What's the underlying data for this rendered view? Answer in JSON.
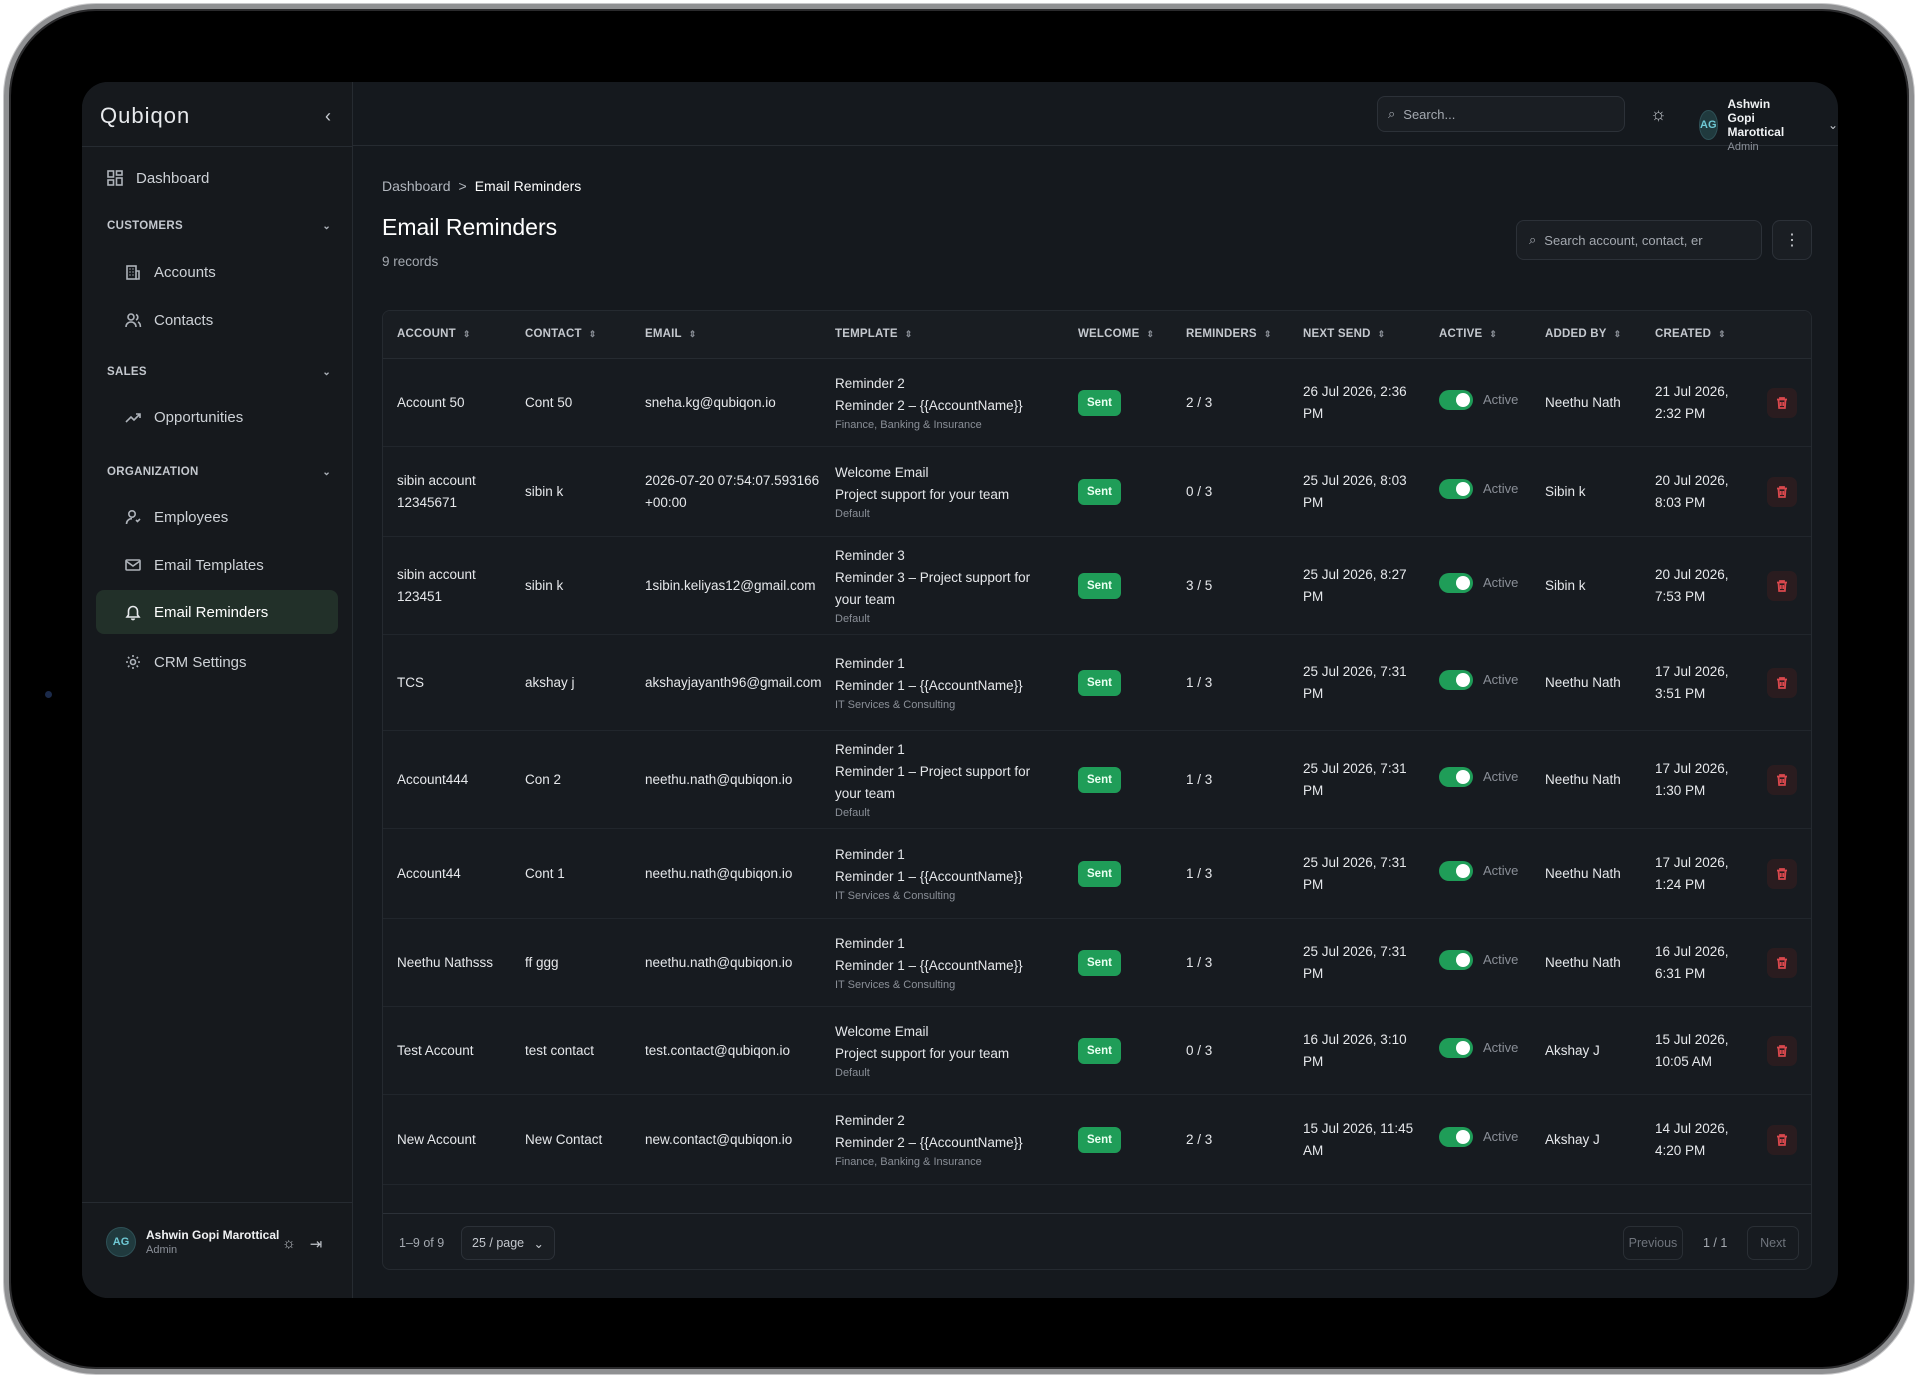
{
  "app": {
    "brand": "Qubiqon"
  },
  "sidebar": {
    "dashboard": "Dashboard",
    "sections": [
      {
        "title": "CUSTOMERS",
        "items": [
          "Accounts",
          "Contacts"
        ]
      },
      {
        "title": "SALES",
        "items": [
          "Opportunities"
        ]
      },
      {
        "title": "ORGANIZATION",
        "items": [
          "Employees",
          "Email Templates",
          "Email Reminders",
          "CRM Settings"
        ]
      }
    ],
    "active_item": "Email Reminders"
  },
  "user": {
    "initials": "AG",
    "name": "Ashwin Gopi Marottical",
    "role": "Admin"
  },
  "topbar": {
    "search_placeholder": "Search..."
  },
  "breadcrumb": {
    "root": "Dashboard",
    "separator": ">",
    "current": "Email Reminders"
  },
  "page": {
    "title": "Email Reminders",
    "records": "9 records",
    "search_placeholder": "Search account, contact, er"
  },
  "table": {
    "columns": [
      "ACCOUNT",
      "CONTACT",
      "EMAIL",
      "TEMPLATE",
      "WELCOME",
      "REMINDERS",
      "NEXT SEND",
      "ACTIVE",
      "ADDED BY",
      "CREATED"
    ],
    "rows": [
      {
        "account": "Account 50",
        "contact": "Cont 50",
        "email": "sneha.kg@qubiqon.io",
        "template_title": "Reminder 2",
        "template_subject": "Reminder 2 – {{AccountName}}",
        "template_category": "Finance, Banking & Insurance",
        "welcome": "Sent",
        "reminders": "2 / 3",
        "next_send": "26 Jul 2026, 2:36 PM",
        "active": "Active",
        "added_by": "Neethu Nath",
        "created": "21 Jul 2026, 2:32 PM"
      },
      {
        "account": "sibin account 12345671",
        "contact": "sibin k",
        "email": "2026-07-20 07:54:07.593166 +00:00",
        "template_title": "Welcome Email",
        "template_subject": "Project support for your team",
        "template_category": "Default",
        "welcome": "Sent",
        "reminders": "0 / 3",
        "next_send": "25 Jul 2026, 8:03 PM",
        "active": "Active",
        "added_by": "Sibin k",
        "created": "20 Jul 2026, 8:03 PM"
      },
      {
        "account": "sibin account 123451",
        "contact": "sibin k",
        "email": "1sibin.keliyas12@gmail.com",
        "template_title": "Reminder 3",
        "template_subject": "Reminder 3 – Project support for your team",
        "template_category": "Default",
        "welcome": "Sent",
        "reminders": "3 / 5",
        "next_send": "25 Jul 2026, 8:27 PM",
        "active": "Active",
        "added_by": "Sibin k",
        "created": "20 Jul 2026, 7:53 PM"
      },
      {
        "account": "TCS",
        "contact": "akshay j",
        "email": "akshayjayanth96@gmail.com",
        "template_title": "Reminder 1",
        "template_subject": "Reminder 1 – {{AccountName}}",
        "template_category": "IT Services & Consulting",
        "welcome": "Sent",
        "reminders": "1 / 3",
        "next_send": "25 Jul 2026, 7:31 PM",
        "active": "Active",
        "added_by": "Neethu Nath",
        "created": "17 Jul 2026, 3:51 PM"
      },
      {
        "account": "Account444",
        "contact": "Con 2",
        "email": "neethu.nath@qubiqon.io",
        "template_title": "Reminder 1",
        "template_subject": "Reminder 1 – Project support for your team",
        "template_category": "Default",
        "welcome": "Sent",
        "reminders": "1 / 3",
        "next_send": "25 Jul 2026, 7:31 PM",
        "active": "Active",
        "added_by": "Neethu Nath",
        "created": "17 Jul 2026, 1:30 PM"
      },
      {
        "account": "Account44",
        "contact": "Cont 1",
        "email": "neethu.nath@qubiqon.io",
        "template_title": "Reminder 1",
        "template_subject": "Reminder 1 – {{AccountName}}",
        "template_category": "IT Services & Consulting",
        "welcome": "Sent",
        "reminders": "1 / 3",
        "next_send": "25 Jul 2026, 7:31 PM",
        "active": "Active",
        "added_by": "Neethu Nath",
        "created": "17 Jul 2026, 1:24 PM"
      },
      {
        "account": "Neethu Nathsss",
        "contact": "ff ggg",
        "email": "neethu.nath@qubiqon.io",
        "template_title": "Reminder 1",
        "template_subject": "Reminder 1 – {{AccountName}}",
        "template_category": "IT Services & Consulting",
        "welcome": "Sent",
        "reminders": "1 / 3",
        "next_send": "25 Jul 2026, 7:31 PM",
        "active": "Active",
        "added_by": "Neethu Nath",
        "created": "16 Jul 2026, 6:31 PM"
      },
      {
        "account": "Test Account",
        "contact": "test contact",
        "email": "test.contact@qubiqon.io",
        "template_title": "Welcome Email",
        "template_subject": "Project support for your team",
        "template_category": "Default",
        "welcome": "Sent",
        "reminders": "0 / 3",
        "next_send": "16 Jul 2026, 3:10 PM",
        "active": "Active",
        "added_by": "Akshay J",
        "created": "15 Jul 2026, 10:05 AM"
      },
      {
        "account": "New Account",
        "contact": "New Contact",
        "email": "new.contact@qubiqon.io",
        "template_title": "Reminder 2",
        "template_subject": "Reminder 2 – {{AccountName}}",
        "template_category": "Finance, Banking & Insurance",
        "welcome": "Sent",
        "reminders": "2 / 3",
        "next_send": "15 Jul 2026, 11:45 AM",
        "active": "Active",
        "added_by": "Akshay J",
        "created": "14 Jul 2026, 4:20 PM"
      }
    ]
  },
  "pagination": {
    "range": "1–9 of 9",
    "per_page": "25 / page",
    "previous": "Previous",
    "page": "1 / 1",
    "next": "Next"
  },
  "colors": {
    "accent": "#1f9d58",
    "brand": "#3fd089",
    "danger": "#d9484d",
    "background": "#15191e"
  }
}
